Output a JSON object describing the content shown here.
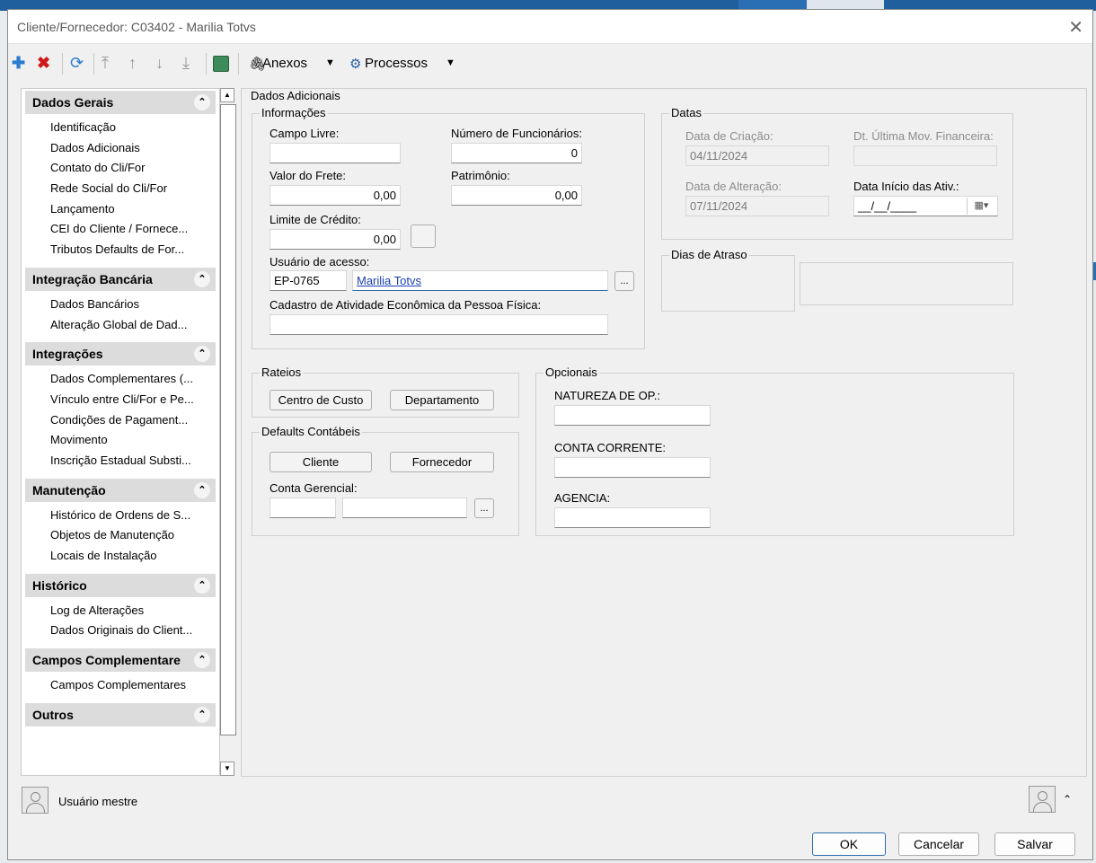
{
  "window": {
    "title": "Cliente/Fornecedor: C03402 - Marilia Totvs",
    "close_glyph": "✕"
  },
  "toolbar": {
    "add_icon": "plus-icon",
    "delete_icon": "delete-icon",
    "refresh_icon": "refresh-icon",
    "anexos_label": "Anexos",
    "processos_label": "Processos"
  },
  "nav": {
    "groups": [
      {
        "title": "Dados Gerais",
        "items": [
          "Identificação",
          "Dados Adicionais",
          "Contato do Cli/For",
          "Rede Social do Cli/For",
          "Lançamento",
          "CEI do Cliente / Fornece...",
          "Tributos Defaults de For..."
        ]
      },
      {
        "title": "Integração Bancária",
        "items": [
          "Dados Bancários",
          "Alteração Global de Dad..."
        ]
      },
      {
        "title": "Integrações",
        "items": [
          "Dados Complementares (...",
          "Vínculo entre Cli/For e Pe...",
          "Condições de Pagament...",
          "Movimento",
          "Inscrição Estadual Substi..."
        ]
      },
      {
        "title": "Manutenção",
        "items": [
          "Histórico de Ordens de S...",
          "Objetos de Manutenção",
          "Locais de Instalação"
        ]
      },
      {
        "title": "Histórico",
        "items": [
          "Log de Alterações",
          "Dados Originais do Client..."
        ]
      },
      {
        "title": "Campos Complementare",
        "items": [
          "Campos Complementares"
        ]
      },
      {
        "title": "Outros",
        "items": []
      }
    ]
  },
  "form": {
    "section_title": "Dados Adicionais",
    "info": {
      "title": "Informações",
      "campo_livre_label": "Campo Livre:",
      "campo_livre_value": "",
      "num_func_label": "Número de Funcionários:",
      "num_func_value": "0",
      "valor_frete_label": "Valor do Frete:",
      "valor_frete_value": "0,00",
      "patrimonio_label": "Patrimônio:",
      "patrimonio_value": "0,00",
      "limite_label": "Limite de Crédito:",
      "limite_value": "0,00",
      "usuario_label": "Usuário de acesso:",
      "usuario_code": "EP-0765",
      "usuario_name": "Marilia Totvs",
      "cadastro_label": "Cadastro de Atividade Econômica da Pessoa Física:",
      "cadastro_value": "",
      "ellipsis": "..."
    },
    "datas": {
      "title": "Datas",
      "criacao_label": "Data de Criação:",
      "criacao_value": "04/11/2024",
      "ult_mov_label": "Dt. Última Mov. Financeira:",
      "ult_mov_value": "",
      "alteracao_label": "Data de Alteração:",
      "alteracao_value": "07/11/2024",
      "inicio_label": "Data Início das Ativ.:",
      "inicio_value": "__/__/____"
    },
    "atraso": {
      "title": "Dias de Atraso"
    },
    "rateios": {
      "title": "Rateios",
      "centro_custo": "Centro de Custo",
      "departamento": "Departamento"
    },
    "defaults": {
      "title": "Defaults Contábeis",
      "cliente": "Cliente",
      "fornecedor": "Fornecedor",
      "conta_gerencial_label": "Conta Gerencial:",
      "ellipsis": "..."
    },
    "opcionais": {
      "title": "Opcionais",
      "natureza_label": "NATUREZA DE OP.:",
      "conta_label": "CONTA CORRENTE:",
      "agencia_label": "AGENCIA:"
    }
  },
  "status": {
    "user_label": "Usuário mestre"
  },
  "footer": {
    "ok": "OK",
    "cancelar": "Cancelar",
    "salvar": "Salvar"
  }
}
